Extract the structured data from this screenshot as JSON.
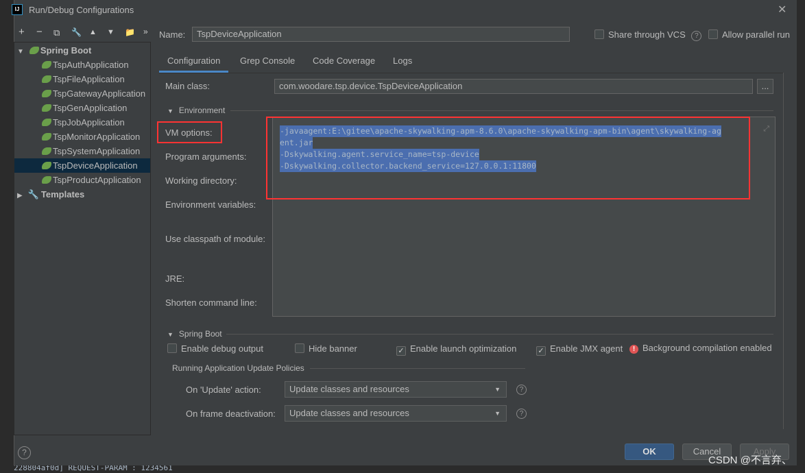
{
  "window": {
    "title": "Run/Debug Configurations",
    "app_icon": "IJ"
  },
  "toolbar": {
    "add": "+",
    "remove": "−",
    "copy": "⧉",
    "edit": "🔧",
    "up": "▲",
    "down": "▼",
    "folder": "📁",
    "more": "»"
  },
  "tree": {
    "group": "Spring Boot",
    "items": [
      "TspAuthApplication",
      "TspFileApplication",
      "TspGatewayApplication",
      "TspGenApplication",
      "TspJobApplication",
      "TspMonitorApplication",
      "TspSystemApplication",
      "TspDeviceApplication",
      "TspProductApplication"
    ],
    "selected": "TspDeviceApplication",
    "templates": "Templates"
  },
  "name": {
    "label": "Name:",
    "value": "TspDeviceApplication"
  },
  "share_vcs": {
    "label": "Share through VCS",
    "checked": false
  },
  "allow_parallel": {
    "label": "Allow parallel run",
    "checked": false
  },
  "tabs": [
    "Configuration",
    "Grep Console",
    "Code Coverage",
    "Logs"
  ],
  "active_tab": "Configuration",
  "main_class": {
    "label": "Main class:",
    "value": "com.woodare.tsp.device.TspDeviceApplication",
    "browse": "..."
  },
  "environment": {
    "label": "Environment"
  },
  "fields": {
    "vm_options": "VM options:",
    "program_arguments": "Program arguments:",
    "working_directory": "Working directory:",
    "environment_variables": "Environment variables:",
    "classpath": "Use classpath of module:",
    "jre": "JRE:",
    "shorten": "Shorten command line:"
  },
  "vm_options_lines": [
    "-javaagent:E:\\gitee\\apache-skywalking-apm-8.6.0\\apache-skywalking-apm-bin\\agent\\skywalking-ag",
    "ent.jar",
    "-Dskywalking.agent.service_name=tsp-device",
    "-Dskywalking.collector.backend_service=127.0.0.1:11800"
  ],
  "spring_boot": {
    "label": "Spring Boot",
    "debug_output": {
      "label": "Enable debug output",
      "checked": false
    },
    "hide_banner": {
      "label": "Hide banner",
      "checked": false
    },
    "launch_opt": {
      "label": "Enable launch optimization",
      "checked": true
    },
    "jmx": {
      "label": "Enable JMX agent",
      "checked": true
    },
    "bg_compile": "Background compilation enabled",
    "policies": "Running Application Update Policies",
    "on_update": {
      "label": "On 'Update' action:",
      "value": "Update classes and resources"
    },
    "on_frame": {
      "label": "On frame deactivation:",
      "value": "Update classes and resources"
    }
  },
  "buttons": {
    "ok": "OK",
    "cancel": "Cancel",
    "apply": "Apply",
    "help": "?"
  },
  "watermark": "CSDN @不言弃、",
  "background_log": "228804af0d] REQUEST-PARAM : 1234561",
  "colors": {
    "accent": "#4a88c7",
    "selection": "#4b6eaf",
    "highlight_box": "#ff3333",
    "ok_button": "#365880"
  }
}
